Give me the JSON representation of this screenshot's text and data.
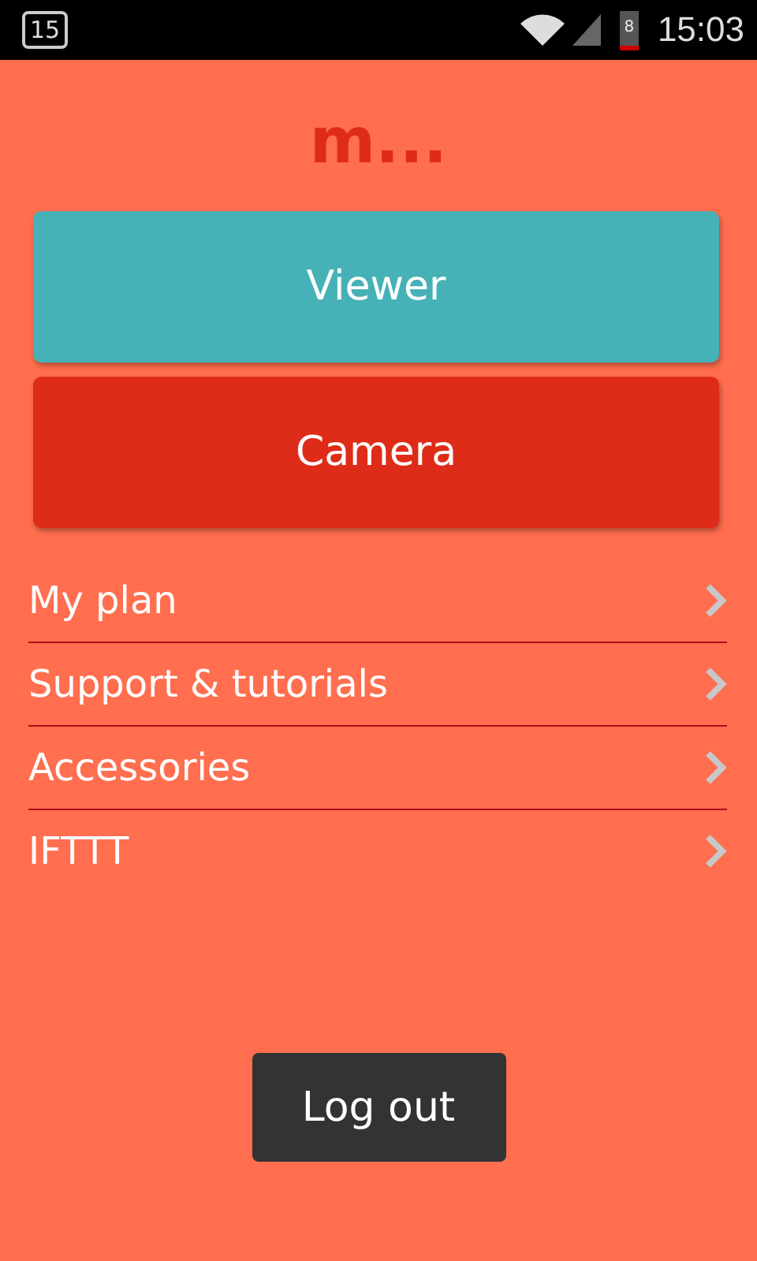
{
  "status_bar": {
    "calendar_day": "15",
    "battery": "8",
    "time": "15:03"
  },
  "logo": "m...",
  "buttons": [
    {
      "label": "Viewer",
      "color": "#46b1b6"
    },
    {
      "label": "Camera",
      "color": "#de2c18"
    }
  ],
  "menu": [
    {
      "label": "My plan"
    },
    {
      "label": "Support & tutorials"
    },
    {
      "label": "Accessories"
    },
    {
      "label": "IFTTT"
    }
  ],
  "logout": "Log out"
}
